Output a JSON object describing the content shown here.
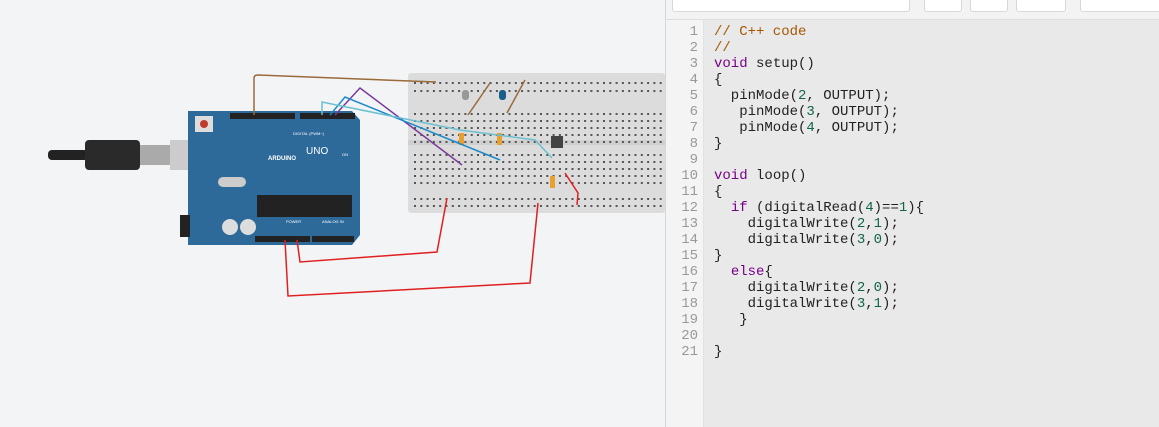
{
  "board": {
    "logo_text": "ARDUINO",
    "model": "UNO",
    "digital_label": "DIGITAL (PWM~)",
    "power_label": "POWER",
    "analog_label": "ANALOG IN",
    "on_label": "ON"
  },
  "editor": {
    "lines": [
      [
        [
          "// C++ code",
          "cm"
        ]
      ],
      [
        [
          "//",
          "cm"
        ]
      ],
      [
        [
          "void",
          "kw"
        ],
        [
          " setup()",
          "pl"
        ]
      ],
      [
        [
          "{",
          "pl"
        ]
      ],
      [
        [
          "  pinMode(",
          "pl"
        ],
        [
          "2",
          "nu"
        ],
        [
          ", OUTPUT);",
          "pl"
        ]
      ],
      [
        [
          "   pinMode(",
          "pl"
        ],
        [
          "3",
          "nu"
        ],
        [
          ", OUTPUT);",
          "pl"
        ]
      ],
      [
        [
          "   pinMode(",
          "pl"
        ],
        [
          "4",
          "nu"
        ],
        [
          ", OUTPUT);",
          "pl"
        ]
      ],
      [
        [
          "}",
          "pl"
        ]
      ],
      [
        [
          "",
          "pl"
        ]
      ],
      [
        [
          "void",
          "kw"
        ],
        [
          " loop()",
          "pl"
        ]
      ],
      [
        [
          "{",
          "pl"
        ]
      ],
      [
        [
          "  ",
          "pl"
        ],
        [
          "if",
          "kw"
        ],
        [
          " (digitalRead(",
          "pl"
        ],
        [
          "4",
          "nu"
        ],
        [
          ")==",
          "pl"
        ],
        [
          "1",
          "nu"
        ],
        [
          "){",
          "pl"
        ]
      ],
      [
        [
          "    digitalWrite(",
          "pl"
        ],
        [
          "2",
          "nu"
        ],
        [
          ",",
          "pl"
        ],
        [
          "1",
          "nu"
        ],
        [
          ");",
          "pl"
        ]
      ],
      [
        [
          "    digitalWrite(",
          "pl"
        ],
        [
          "3",
          "nu"
        ],
        [
          ",",
          "pl"
        ],
        [
          "0",
          "nu"
        ],
        [
          ");",
          "pl"
        ]
      ],
      [
        [
          "}",
          "pl"
        ]
      ],
      [
        [
          "  ",
          "pl"
        ],
        [
          "else",
          "kw"
        ],
        [
          "{",
          "pl"
        ]
      ],
      [
        [
          "    digitalWrite(",
          "pl"
        ],
        [
          "2",
          "nu"
        ],
        [
          ",",
          "pl"
        ],
        [
          "0",
          "nu"
        ],
        [
          ");",
          "pl"
        ]
      ],
      [
        [
          "    digitalWrite(",
          "pl"
        ],
        [
          "3",
          "nu"
        ],
        [
          ",",
          "pl"
        ],
        [
          "1",
          "nu"
        ],
        [
          ");",
          "pl"
        ]
      ],
      [
        [
          "   }",
          "pl"
        ]
      ],
      [
        [
          "",
          "pl"
        ]
      ],
      [
        [
          "}",
          "pl"
        ]
      ]
    ]
  },
  "colors": {
    "board": "#2d6a9a",
    "wire_red": "#e02020",
    "wire_brown": "#9a6a3a",
    "wire_purple": "#7a3a9a",
    "wire_blue": "#1a8ac8",
    "wire_cyan": "#6ac0d0"
  }
}
